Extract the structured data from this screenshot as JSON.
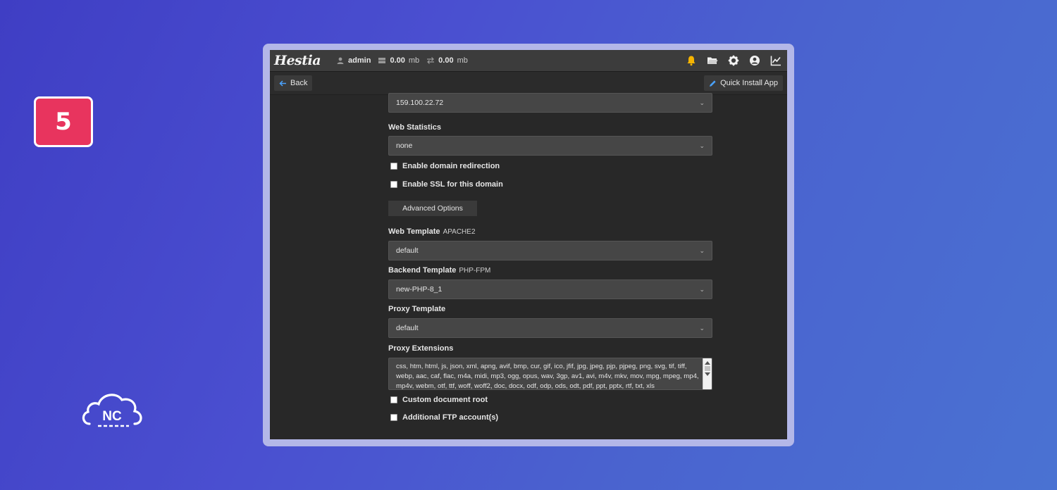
{
  "step_number": "5",
  "brand_logo_text": "NC",
  "topbar": {
    "logo": "Hestia",
    "user": "admin",
    "disk_value": "0.00",
    "disk_unit": "mb",
    "bandwidth_value": "0.00",
    "bandwidth_unit": "mb",
    "icons": [
      "bell-icon",
      "folder-icon",
      "gear-icon",
      "user-circle-icon",
      "chart-icon"
    ]
  },
  "toolbar": {
    "back_label": "Back",
    "quick_install_label": "Quick Install App"
  },
  "form": {
    "ip_address": "159.100.22.72",
    "web_statistics_label": "Web Statistics",
    "web_statistics_value": "none",
    "enable_redirection_label": "Enable domain redirection",
    "enable_ssl_label": "Enable SSL for this domain",
    "advanced_options_label": "Advanced Options",
    "web_template_label": "Web Template",
    "web_template_sub": "APACHE2",
    "web_template_value": "default",
    "backend_template_label": "Backend Template",
    "backend_template_sub": "PHP-FPM",
    "backend_template_value": "new-PHP-8_1",
    "proxy_template_label": "Proxy Template",
    "proxy_template_value": "default",
    "proxy_extensions_label": "Proxy Extensions",
    "proxy_extensions_value": "css, htm, html, js, json, xml, apng, avif, bmp, cur, gif, ico, jfif, jpg, jpeg, pjp, pjpeg, png, svg, tif, tiff, webp, aac, caf, flac, m4a, midi, mp3, ogg, opus, wav, 3gp, av1, avi, m4v, mkv, mov, mpg, mpeg, mp4, mp4v, webm, otf, ttf, woff, woff2, doc, docx, odf, odp, ods, odt, pdf, ppt, pptx, rtf, txt, xls",
    "custom_docroot_label": "Custom document root",
    "additional_ftp_label": "Additional FTP account(s)"
  }
}
